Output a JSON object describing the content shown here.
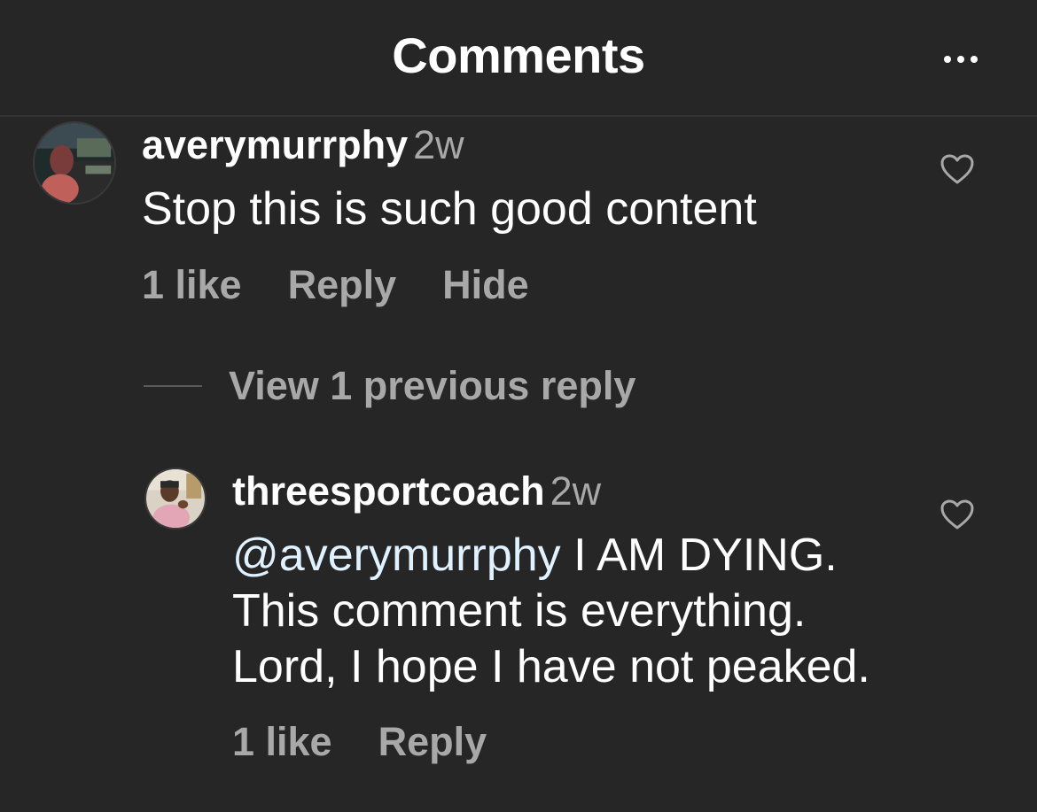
{
  "header": {
    "title": "Comments",
    "more_icon": "more-horizontal-icon"
  },
  "comments": [
    {
      "username": "averymurrphy",
      "time": "2w",
      "text": "Stop this is such good content",
      "likes": "1 like",
      "reply_label": "Reply",
      "hide_label": "Hide",
      "avatar_icon": "user-avatar"
    }
  ],
  "replies_toggle": {
    "label": "View 1 previous reply"
  },
  "replies": [
    {
      "username": "threesportcoach",
      "time": "2w",
      "mention": "@averymurrphy",
      "text_line1": " I AM DYING.",
      "text_line2": "This comment is everything.",
      "text_line3": "Lord, I hope I have not peaked.",
      "likes": "1 like",
      "reply_label": "Reply",
      "avatar_icon": "user-avatar"
    }
  ],
  "colors": {
    "background": "#262626",
    "text_primary": "#ffffff",
    "text_secondary": "#a8a8a8",
    "mention": "#e0f1ff",
    "divider": "#333333"
  }
}
